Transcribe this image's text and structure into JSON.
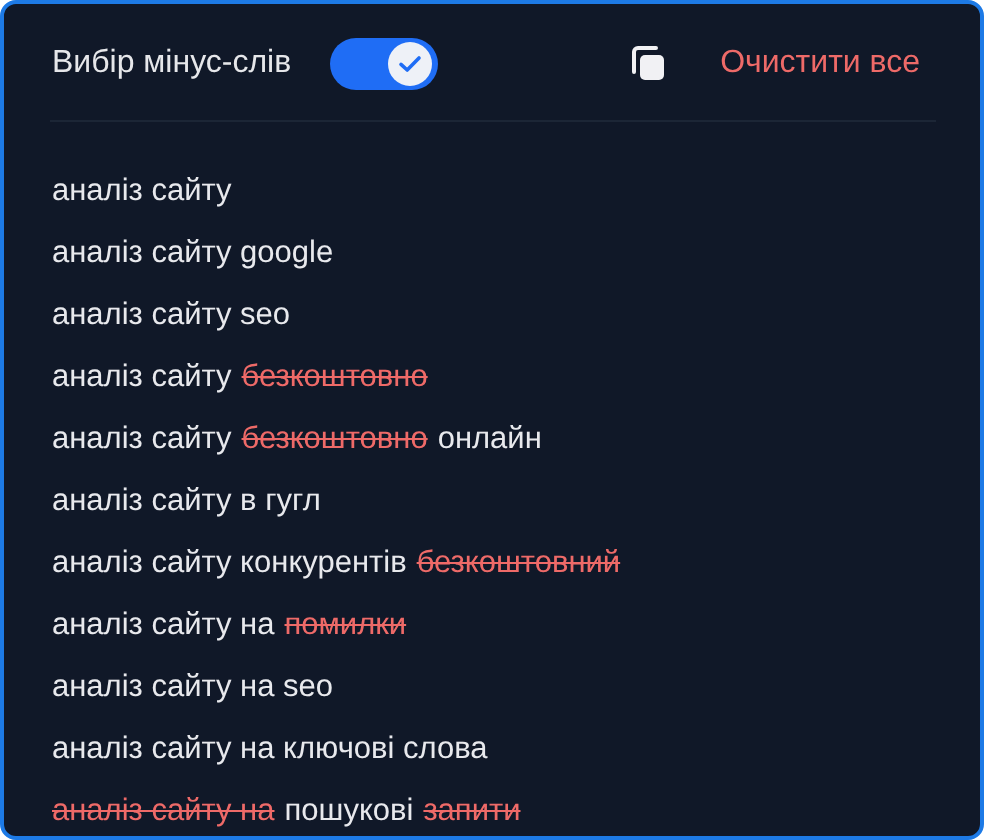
{
  "header": {
    "label": "Вибір мінус-слів",
    "toggle": {
      "on": true
    },
    "clear_button": "Очистити все"
  },
  "phrases": [
    {
      "segments": [
        {
          "text": "аналіз сайту",
          "excluded": false
        }
      ]
    },
    {
      "segments": [
        {
          "text": "аналіз сайту google",
          "excluded": false
        }
      ]
    },
    {
      "segments": [
        {
          "text": "аналіз сайту seo",
          "excluded": false
        }
      ]
    },
    {
      "segments": [
        {
          "text": "аналіз сайту",
          "excluded": false
        },
        {
          "text": "безкоштовно",
          "excluded": true
        }
      ]
    },
    {
      "segments": [
        {
          "text": "аналіз сайту",
          "excluded": false
        },
        {
          "text": "безкоштовно",
          "excluded": true
        },
        {
          "text": "онлайн",
          "excluded": false
        }
      ]
    },
    {
      "segments": [
        {
          "text": "аналіз сайту в гугл",
          "excluded": false
        }
      ]
    },
    {
      "segments": [
        {
          "text": "аналіз сайту конкурентів",
          "excluded": false
        },
        {
          "text": "безкоштовний",
          "excluded": true
        }
      ]
    },
    {
      "segments": [
        {
          "text": "аналіз сайту на",
          "excluded": false
        },
        {
          "text": "помилки",
          "excluded": true
        }
      ]
    },
    {
      "segments": [
        {
          "text": "аналіз сайту на seo",
          "excluded": false
        }
      ]
    },
    {
      "segments": [
        {
          "text": "аналіз сайту на ключові слова",
          "excluded": false
        }
      ]
    },
    {
      "segments": [
        {
          "text": "аналіз сайту на",
          "excluded": true
        },
        {
          "text": "пошукові",
          "excluded": false
        },
        {
          "text": "запити",
          "excluded": true
        }
      ]
    }
  ]
}
